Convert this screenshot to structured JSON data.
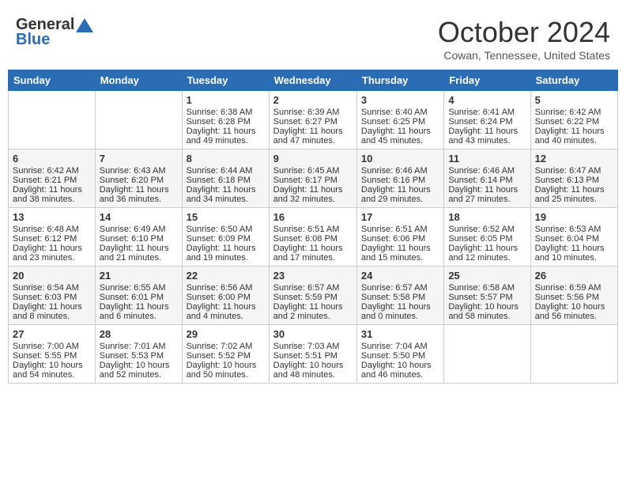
{
  "header": {
    "logo_general": "General",
    "logo_blue": "Blue",
    "month_title": "October 2024",
    "location": "Cowan, Tennessee, United States"
  },
  "weekdays": [
    "Sunday",
    "Monday",
    "Tuesday",
    "Wednesday",
    "Thursday",
    "Friday",
    "Saturday"
  ],
  "weeks": [
    [
      {
        "day": "",
        "info": ""
      },
      {
        "day": "",
        "info": ""
      },
      {
        "day": "1",
        "info": "Sunrise: 6:38 AM\nSunset: 6:28 PM\nDaylight: 11 hours and 49 minutes."
      },
      {
        "day": "2",
        "info": "Sunrise: 6:39 AM\nSunset: 6:27 PM\nDaylight: 11 hours and 47 minutes."
      },
      {
        "day": "3",
        "info": "Sunrise: 6:40 AM\nSunset: 6:25 PM\nDaylight: 11 hours and 45 minutes."
      },
      {
        "day": "4",
        "info": "Sunrise: 6:41 AM\nSunset: 6:24 PM\nDaylight: 11 hours and 43 minutes."
      },
      {
        "day": "5",
        "info": "Sunrise: 6:42 AM\nSunset: 6:22 PM\nDaylight: 11 hours and 40 minutes."
      }
    ],
    [
      {
        "day": "6",
        "info": "Sunrise: 6:42 AM\nSunset: 6:21 PM\nDaylight: 11 hours and 38 minutes."
      },
      {
        "day": "7",
        "info": "Sunrise: 6:43 AM\nSunset: 6:20 PM\nDaylight: 11 hours and 36 minutes."
      },
      {
        "day": "8",
        "info": "Sunrise: 6:44 AM\nSunset: 6:18 PM\nDaylight: 11 hours and 34 minutes."
      },
      {
        "day": "9",
        "info": "Sunrise: 6:45 AM\nSunset: 6:17 PM\nDaylight: 11 hours and 32 minutes."
      },
      {
        "day": "10",
        "info": "Sunrise: 6:46 AM\nSunset: 6:16 PM\nDaylight: 11 hours and 29 minutes."
      },
      {
        "day": "11",
        "info": "Sunrise: 6:46 AM\nSunset: 6:14 PM\nDaylight: 11 hours and 27 minutes."
      },
      {
        "day": "12",
        "info": "Sunrise: 6:47 AM\nSunset: 6:13 PM\nDaylight: 11 hours and 25 minutes."
      }
    ],
    [
      {
        "day": "13",
        "info": "Sunrise: 6:48 AM\nSunset: 6:12 PM\nDaylight: 11 hours and 23 minutes."
      },
      {
        "day": "14",
        "info": "Sunrise: 6:49 AM\nSunset: 6:10 PM\nDaylight: 11 hours and 21 minutes."
      },
      {
        "day": "15",
        "info": "Sunrise: 6:50 AM\nSunset: 6:09 PM\nDaylight: 11 hours and 19 minutes."
      },
      {
        "day": "16",
        "info": "Sunrise: 6:51 AM\nSunset: 6:08 PM\nDaylight: 11 hours and 17 minutes."
      },
      {
        "day": "17",
        "info": "Sunrise: 6:51 AM\nSunset: 6:06 PM\nDaylight: 11 hours and 15 minutes."
      },
      {
        "day": "18",
        "info": "Sunrise: 6:52 AM\nSunset: 6:05 PM\nDaylight: 11 hours and 12 minutes."
      },
      {
        "day": "19",
        "info": "Sunrise: 6:53 AM\nSunset: 6:04 PM\nDaylight: 11 hours and 10 minutes."
      }
    ],
    [
      {
        "day": "20",
        "info": "Sunrise: 6:54 AM\nSunset: 6:03 PM\nDaylight: 11 hours and 8 minutes."
      },
      {
        "day": "21",
        "info": "Sunrise: 6:55 AM\nSunset: 6:01 PM\nDaylight: 11 hours and 6 minutes."
      },
      {
        "day": "22",
        "info": "Sunrise: 6:56 AM\nSunset: 6:00 PM\nDaylight: 11 hours and 4 minutes."
      },
      {
        "day": "23",
        "info": "Sunrise: 6:57 AM\nSunset: 5:59 PM\nDaylight: 11 hours and 2 minutes."
      },
      {
        "day": "24",
        "info": "Sunrise: 6:57 AM\nSunset: 5:58 PM\nDaylight: 11 hours and 0 minutes."
      },
      {
        "day": "25",
        "info": "Sunrise: 6:58 AM\nSunset: 5:57 PM\nDaylight: 10 hours and 58 minutes."
      },
      {
        "day": "26",
        "info": "Sunrise: 6:59 AM\nSunset: 5:56 PM\nDaylight: 10 hours and 56 minutes."
      }
    ],
    [
      {
        "day": "27",
        "info": "Sunrise: 7:00 AM\nSunset: 5:55 PM\nDaylight: 10 hours and 54 minutes."
      },
      {
        "day": "28",
        "info": "Sunrise: 7:01 AM\nSunset: 5:53 PM\nDaylight: 10 hours and 52 minutes."
      },
      {
        "day": "29",
        "info": "Sunrise: 7:02 AM\nSunset: 5:52 PM\nDaylight: 10 hours and 50 minutes."
      },
      {
        "day": "30",
        "info": "Sunrise: 7:03 AM\nSunset: 5:51 PM\nDaylight: 10 hours and 48 minutes."
      },
      {
        "day": "31",
        "info": "Sunrise: 7:04 AM\nSunset: 5:50 PM\nDaylight: 10 hours and 46 minutes."
      },
      {
        "day": "",
        "info": ""
      },
      {
        "day": "",
        "info": ""
      }
    ]
  ]
}
